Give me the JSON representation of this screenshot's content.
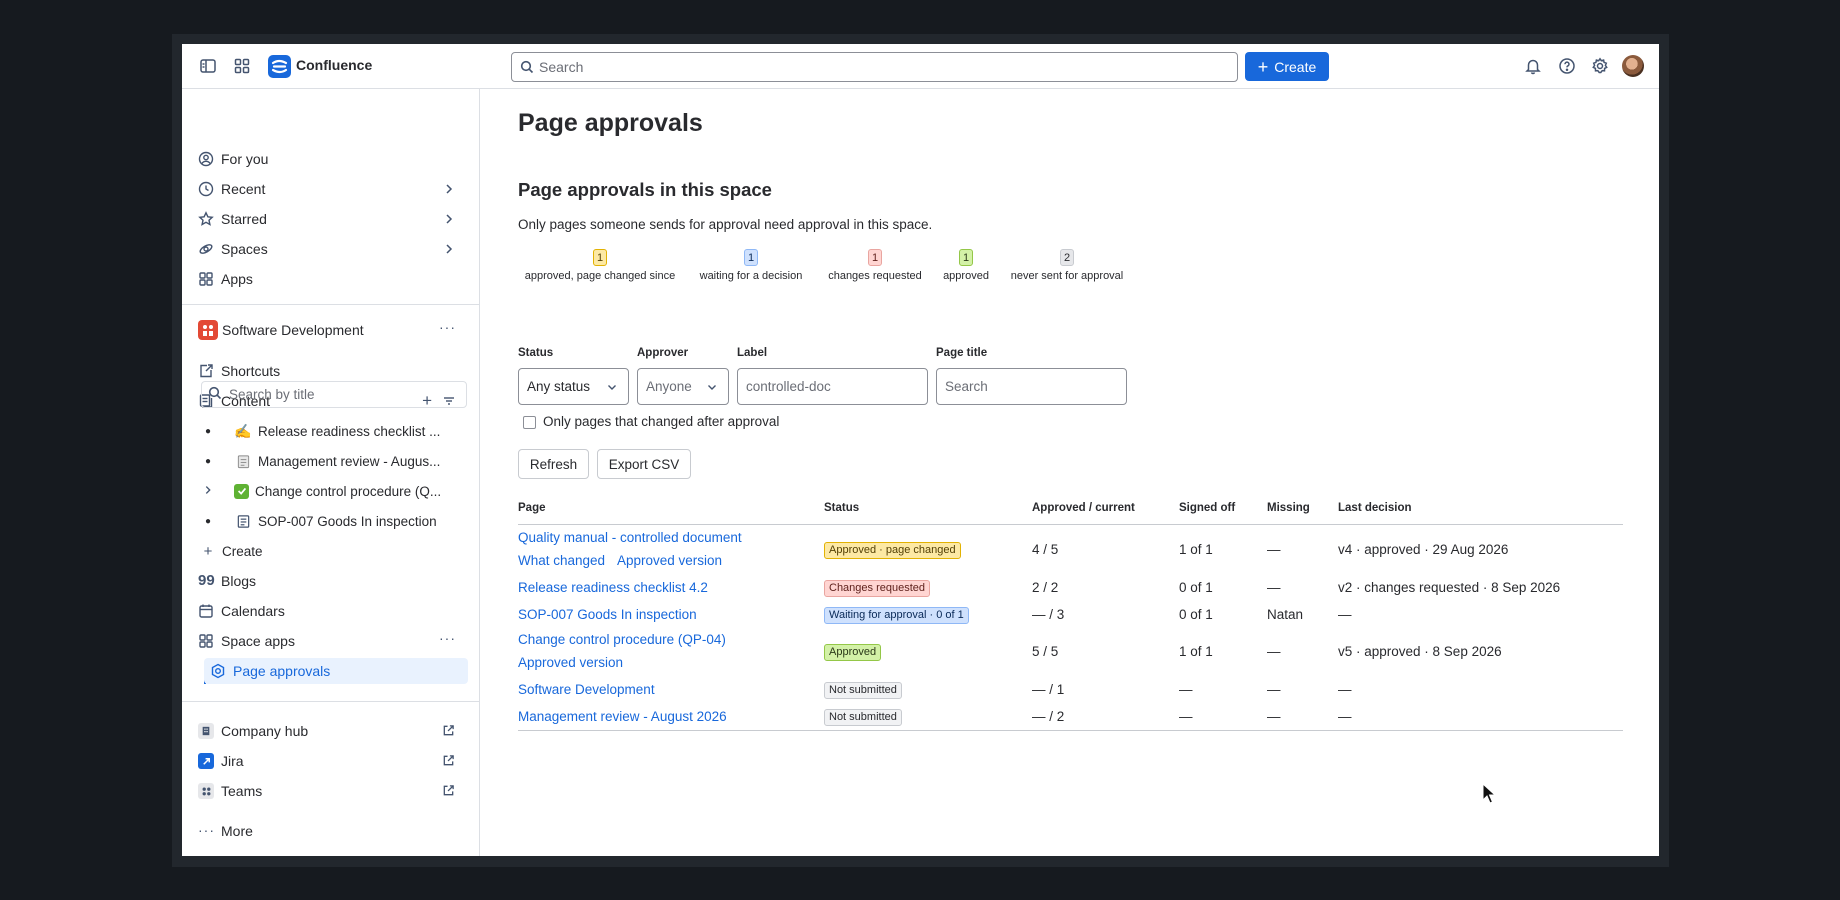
{
  "topbar": {
    "product": "Confluence",
    "search_placeholder": "Search",
    "create_label": "Create"
  },
  "sidebar": {
    "global_nav": [
      {
        "label": "For you",
        "icon": "user-circle-icon"
      },
      {
        "label": "Recent",
        "icon": "clock-icon"
      },
      {
        "label": "Starred",
        "icon": "star-icon"
      },
      {
        "label": "Spaces",
        "icon": "spaces-icon"
      },
      {
        "label": "Apps",
        "icon": "apps-icon"
      }
    ],
    "space_name": "Software Development",
    "shortcuts_label": "Shortcuts",
    "content_label": "Content",
    "search_placeholder": "Search by title",
    "tree": [
      {
        "emoji": "✍️",
        "label": "Release readiness checklist ..."
      },
      {
        "emoji": "🗒️",
        "label": "Management review - Augus..."
      },
      {
        "emoji": "✅",
        "label": "Change control procedure (Q..."
      },
      {
        "emoji": "page-icon",
        "label": "SOP-007 Goods In inspection"
      }
    ],
    "tree_create_label": "Create",
    "blogs_label": "Blogs",
    "calendars_label": "Calendars",
    "space_apps_label": "Space apps",
    "page_approvals_label": "Page approvals",
    "external": [
      {
        "label": "Company hub"
      },
      {
        "label": "Jira"
      },
      {
        "label": "Teams"
      }
    ],
    "more_label": "More"
  },
  "main": {
    "title": "Page approvals",
    "section_title": "Page approvals in this space",
    "description": "Only pages someone sends for approval need approval in this space.",
    "legend": [
      {
        "count": "1",
        "label": "approved, page changed since",
        "color": "#fde9a4"
      },
      {
        "count": "1",
        "label": "waiting for a decision",
        "color": "#cfe1fd"
      },
      {
        "count": "1",
        "label": "changes requested",
        "color": "#ffd5d2"
      },
      {
        "count": "1",
        "label": "approved",
        "color": "#d3f1a7"
      },
      {
        "count": "2",
        "label": "never sent for approval",
        "color": "#e6e7ea"
      }
    ],
    "filters": {
      "status_label": "Status",
      "status_value": "Any status",
      "approver_label": "Approver",
      "approver_value": "Anyone",
      "label_label": "Label",
      "label_placeholder": "controlled-doc",
      "page_title_label": "Page title",
      "page_title_placeholder": "Search"
    },
    "changed_checkbox_label": "Only pages that changed after approval",
    "refresh_label": "Refresh",
    "export_label": "Export CSV",
    "table": {
      "headers": [
        "Page",
        "Status",
        "Approved / current",
        "Signed off",
        "Missing",
        "Last decision"
      ],
      "rows": [
        {
          "page": "Quality manual - controlled document",
          "links": [
            "What changed",
            "Approved version"
          ],
          "status": "Approved · page changed",
          "approved": "4 / 5",
          "signed": "1 of 1",
          "missing": "—",
          "last": "v4 · approved · 29 Aug 2026"
        },
        {
          "page": "Release readiness checklist 4.2",
          "links": [],
          "status": "Changes requested",
          "approved": "2 / 2",
          "signed": "0 of 1",
          "missing": "—",
          "last": "v2 · changes requested · 8 Sep 2026"
        },
        {
          "page": "SOP-007 Goods In inspection",
          "links": [],
          "status": "Waiting for approval · 0 of 1",
          "approved": "— / 3",
          "signed": "0 of 1",
          "missing": "Natan",
          "last": "—"
        },
        {
          "page": "Change control procedure (QP-04)",
          "links": [
            "Approved version"
          ],
          "status": "Approved",
          "approved": "5 / 5",
          "signed": "1 of 1",
          "missing": "—",
          "last": "v5 · approved · 8 Sep 2026"
        },
        {
          "page": "Software Development",
          "links": [],
          "status": "Not submitted",
          "approved": "— / 1",
          "signed": "—",
          "missing": "—",
          "last": "—"
        },
        {
          "page": "Management review - August 2026",
          "links": [],
          "status": "Not submitted",
          "approved": "— / 2",
          "signed": "—",
          "missing": "—",
          "last": "—"
        }
      ]
    }
  }
}
